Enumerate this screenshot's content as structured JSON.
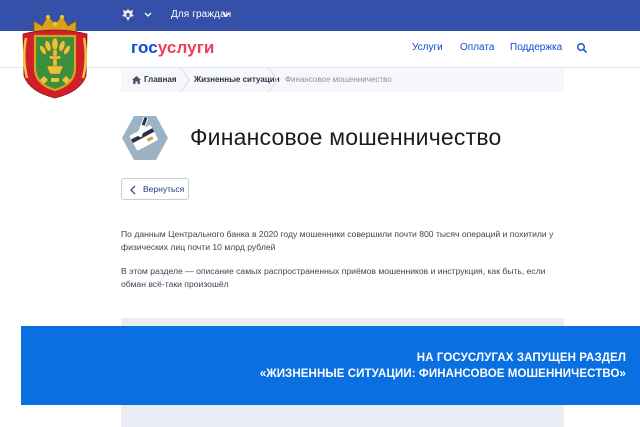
{
  "topbar": {
    "audience_label": "Для граждан"
  },
  "header": {
    "logo": {
      "part1": "гос",
      "part2": "услуги"
    },
    "nav": [
      "Услуги",
      "Оплата",
      "Поддержка"
    ]
  },
  "breadcrumbs": [
    "Главная",
    "Жизненные ситуации",
    "Финансовое мошенничество"
  ],
  "page": {
    "title": "Финансовое мошенничество",
    "back_label": "Вернуться",
    "paragraph1_line1": "По данным Центрального банка в 2020 году мошенники совершили почти 800 тысяч операций и похитили у",
    "paragraph1_line2": "физических лиц почти 10 млрд рублей",
    "paragraph2_line1": "В этом разделе — описание самых распространенных приёмов мошенников и инструкция, как быть, если",
    "paragraph2_line2": "обман всё-таки произошёл"
  },
  "banner": {
    "line1": "НА ГОСУСЛУГАХ ЗАПУЩЕН РАЗДЕЛ",
    "line2": "«ЖИЗНЕННЫЕ СИТУАЦИИ: ФИНАНСОВОЕ МОШЕННИЧЕСТВО»"
  },
  "colors": {
    "topbar": "#3450a8",
    "brand_blue": "#0d4cd3",
    "brand_red": "#ee3f58",
    "banner": "#0a6fe0"
  },
  "icons": [
    "russian-emblem-icon",
    "chevron-down-icon",
    "search-icon",
    "home-icon",
    "chevron-left-icon",
    "credit-card-fraud-icon",
    "coat-of-arms-icon"
  ]
}
